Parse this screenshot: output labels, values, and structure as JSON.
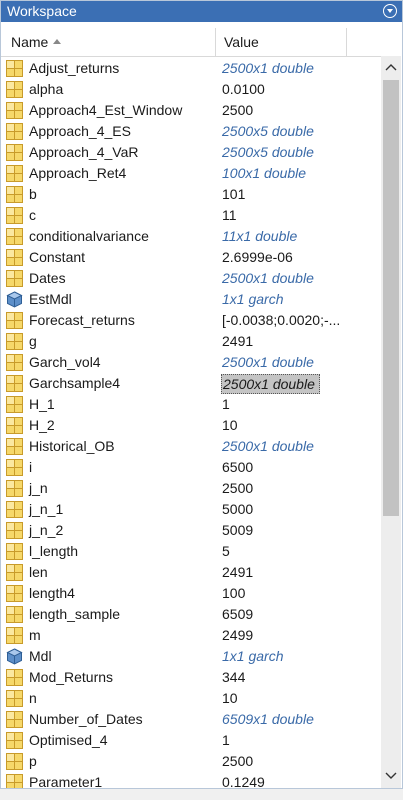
{
  "panel": {
    "title": "Workspace",
    "accent_color": "#3b6fb4",
    "menu_icon": "chevron-down-circle-icon"
  },
  "header": {
    "name_label": "Name",
    "value_label": "Value",
    "sort": "ascending"
  },
  "rows": [
    {
      "name": "Adjust_returns",
      "value": "2500x1 double",
      "type": "matrix",
      "italic": true
    },
    {
      "name": "alpha",
      "value": "0.0100",
      "type": "matrix",
      "italic": false
    },
    {
      "name": "Approach4_Est_Window",
      "value": "2500",
      "type": "matrix",
      "italic": false
    },
    {
      "name": "Approach_4_ES",
      "value": "2500x5 double",
      "type": "matrix",
      "italic": true
    },
    {
      "name": "Approach_4_VaR",
      "value": "2500x5 double",
      "type": "matrix",
      "italic": true
    },
    {
      "name": "Approach_Ret4",
      "value": "100x1 double",
      "type": "matrix",
      "italic": true
    },
    {
      "name": "b",
      "value": "101",
      "type": "matrix",
      "italic": false
    },
    {
      "name": "c",
      "value": "11",
      "type": "matrix",
      "italic": false
    },
    {
      "name": "conditionalvariance",
      "value": "11x1 double",
      "type": "matrix",
      "italic": true
    },
    {
      "name": "Constant",
      "value": "2.6999e-06",
      "type": "matrix",
      "italic": false
    },
    {
      "name": "Dates",
      "value": "2500x1 double",
      "type": "matrix",
      "italic": true
    },
    {
      "name": "EstMdl",
      "value": "1x1 garch",
      "type": "object",
      "italic": true
    },
    {
      "name": "Forecast_returns",
      "value": "[-0.0038;0.0020;-...",
      "type": "matrix",
      "italic": false
    },
    {
      "name": "g",
      "value": "2491",
      "type": "matrix",
      "italic": false
    },
    {
      "name": "Garch_vol4",
      "value": "2500x1 double",
      "type": "matrix",
      "italic": true
    },
    {
      "name": "Garchsample4",
      "value": "2500x1 double",
      "type": "matrix",
      "italic": true,
      "selected": true
    },
    {
      "name": "H_1",
      "value": "1",
      "type": "matrix",
      "italic": false
    },
    {
      "name": "H_2",
      "value": "10",
      "type": "matrix",
      "italic": false
    },
    {
      "name": "Historical_OB",
      "value": "2500x1 double",
      "type": "matrix",
      "italic": true
    },
    {
      "name": "i",
      "value": "6500",
      "type": "matrix",
      "italic": false
    },
    {
      "name": "j_n",
      "value": "2500",
      "type": "matrix",
      "italic": false
    },
    {
      "name": "j_n_1",
      "value": "5000",
      "type": "matrix",
      "italic": false
    },
    {
      "name": "j_n_2",
      "value": "5009",
      "type": "matrix",
      "italic": false
    },
    {
      "name": "l_length",
      "value": "5",
      "type": "matrix",
      "italic": false
    },
    {
      "name": "len",
      "value": "2491",
      "type": "matrix",
      "italic": false
    },
    {
      "name": "length4",
      "value": "100",
      "type": "matrix",
      "italic": false
    },
    {
      "name": "length_sample",
      "value": "6509",
      "type": "matrix",
      "italic": false
    },
    {
      "name": "m",
      "value": "2499",
      "type": "matrix",
      "italic": false
    },
    {
      "name": "Mdl",
      "value": "1x1 garch",
      "type": "object",
      "italic": true
    },
    {
      "name": "Mod_Returns",
      "value": "344",
      "type": "matrix",
      "italic": false
    },
    {
      "name": "n",
      "value": "10",
      "type": "matrix",
      "italic": false
    },
    {
      "name": "Number_of_Dates",
      "value": "6509x1 double",
      "type": "matrix",
      "italic": true
    },
    {
      "name": "Optimised_4",
      "value": "1",
      "type": "matrix",
      "italic": false
    },
    {
      "name": "p",
      "value": "2500",
      "type": "matrix",
      "italic": false
    },
    {
      "name": "Parameter1",
      "value": "0.1249",
      "type": "matrix",
      "italic": false
    }
  ],
  "icons": {
    "matrix": "matrix-variable-icon",
    "object": "object-variable-icon"
  }
}
